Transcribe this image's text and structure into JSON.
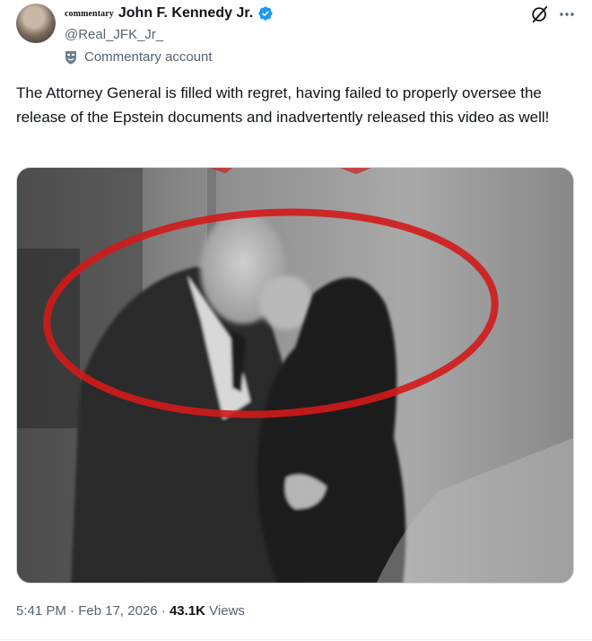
{
  "author": {
    "prefix": "commentary",
    "display_name": "John F. Kennedy Jr.",
    "handle": "@Real_JFK_Jr_",
    "account_label": "Commentary account",
    "verified_color": "#1d9bf0"
  },
  "tweet": {
    "text": "The Attorney General is filled with regret, having failed to properly oversee the release of the Epstein documents and inadvertently released this video as well!"
  },
  "meta": {
    "time": "5:41 PM",
    "separator": " · ",
    "date": "Feb 17, 2026",
    "views_count": "43.1K",
    "views_label": " Views"
  },
  "icons": {
    "grok": "grok-icon",
    "more": "more-icon",
    "verified": "verified-badge-icon",
    "label": "mask-icon"
  },
  "colors": {
    "text_primary": "#0f1419",
    "text_secondary": "#536471",
    "circle_annotation": "#d31a1a"
  }
}
